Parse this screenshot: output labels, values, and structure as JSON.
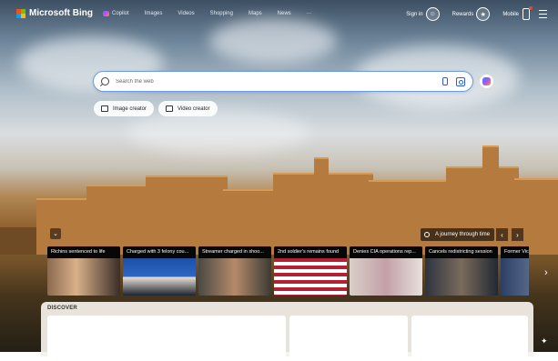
{
  "header": {
    "brand": "Microsoft Bing",
    "nav": [
      {
        "label": "Copilot"
      },
      {
        "label": "Images"
      },
      {
        "label": "Videos"
      },
      {
        "label": "Shopping"
      },
      {
        "label": "Maps"
      },
      {
        "label": "News"
      },
      {
        "label": "···"
      }
    ],
    "sign_in": "Sign in",
    "rewards": "Rewards",
    "mobile": "Mobile"
  },
  "search": {
    "placeholder": "Search the web"
  },
  "creators": {
    "image": "Image creator",
    "video": "Video creator"
  },
  "strip": {
    "journey": "A journey through time",
    "prev": "‹",
    "next": "›",
    "toggle": "⌄",
    "cards": [
      {
        "caption": "Richins sentenced to life"
      },
      {
        "caption": "Charged with 3 felony cou..."
      },
      {
        "caption": "Streamer charged in shoo..."
      },
      {
        "caption": "2nd soldier's remains found"
      },
      {
        "caption": "Denies CIA operations rep..."
      },
      {
        "caption": "Cancels redistricting session"
      },
      {
        "caption": "Former Vic"
      }
    ]
  },
  "discover": {
    "label": "DISCOVER"
  },
  "colors": {
    "accent": "#2a5bd7",
    "logo": [
      "#f25022",
      "#7fba00",
      "#00a4ef",
      "#ffb900"
    ]
  }
}
